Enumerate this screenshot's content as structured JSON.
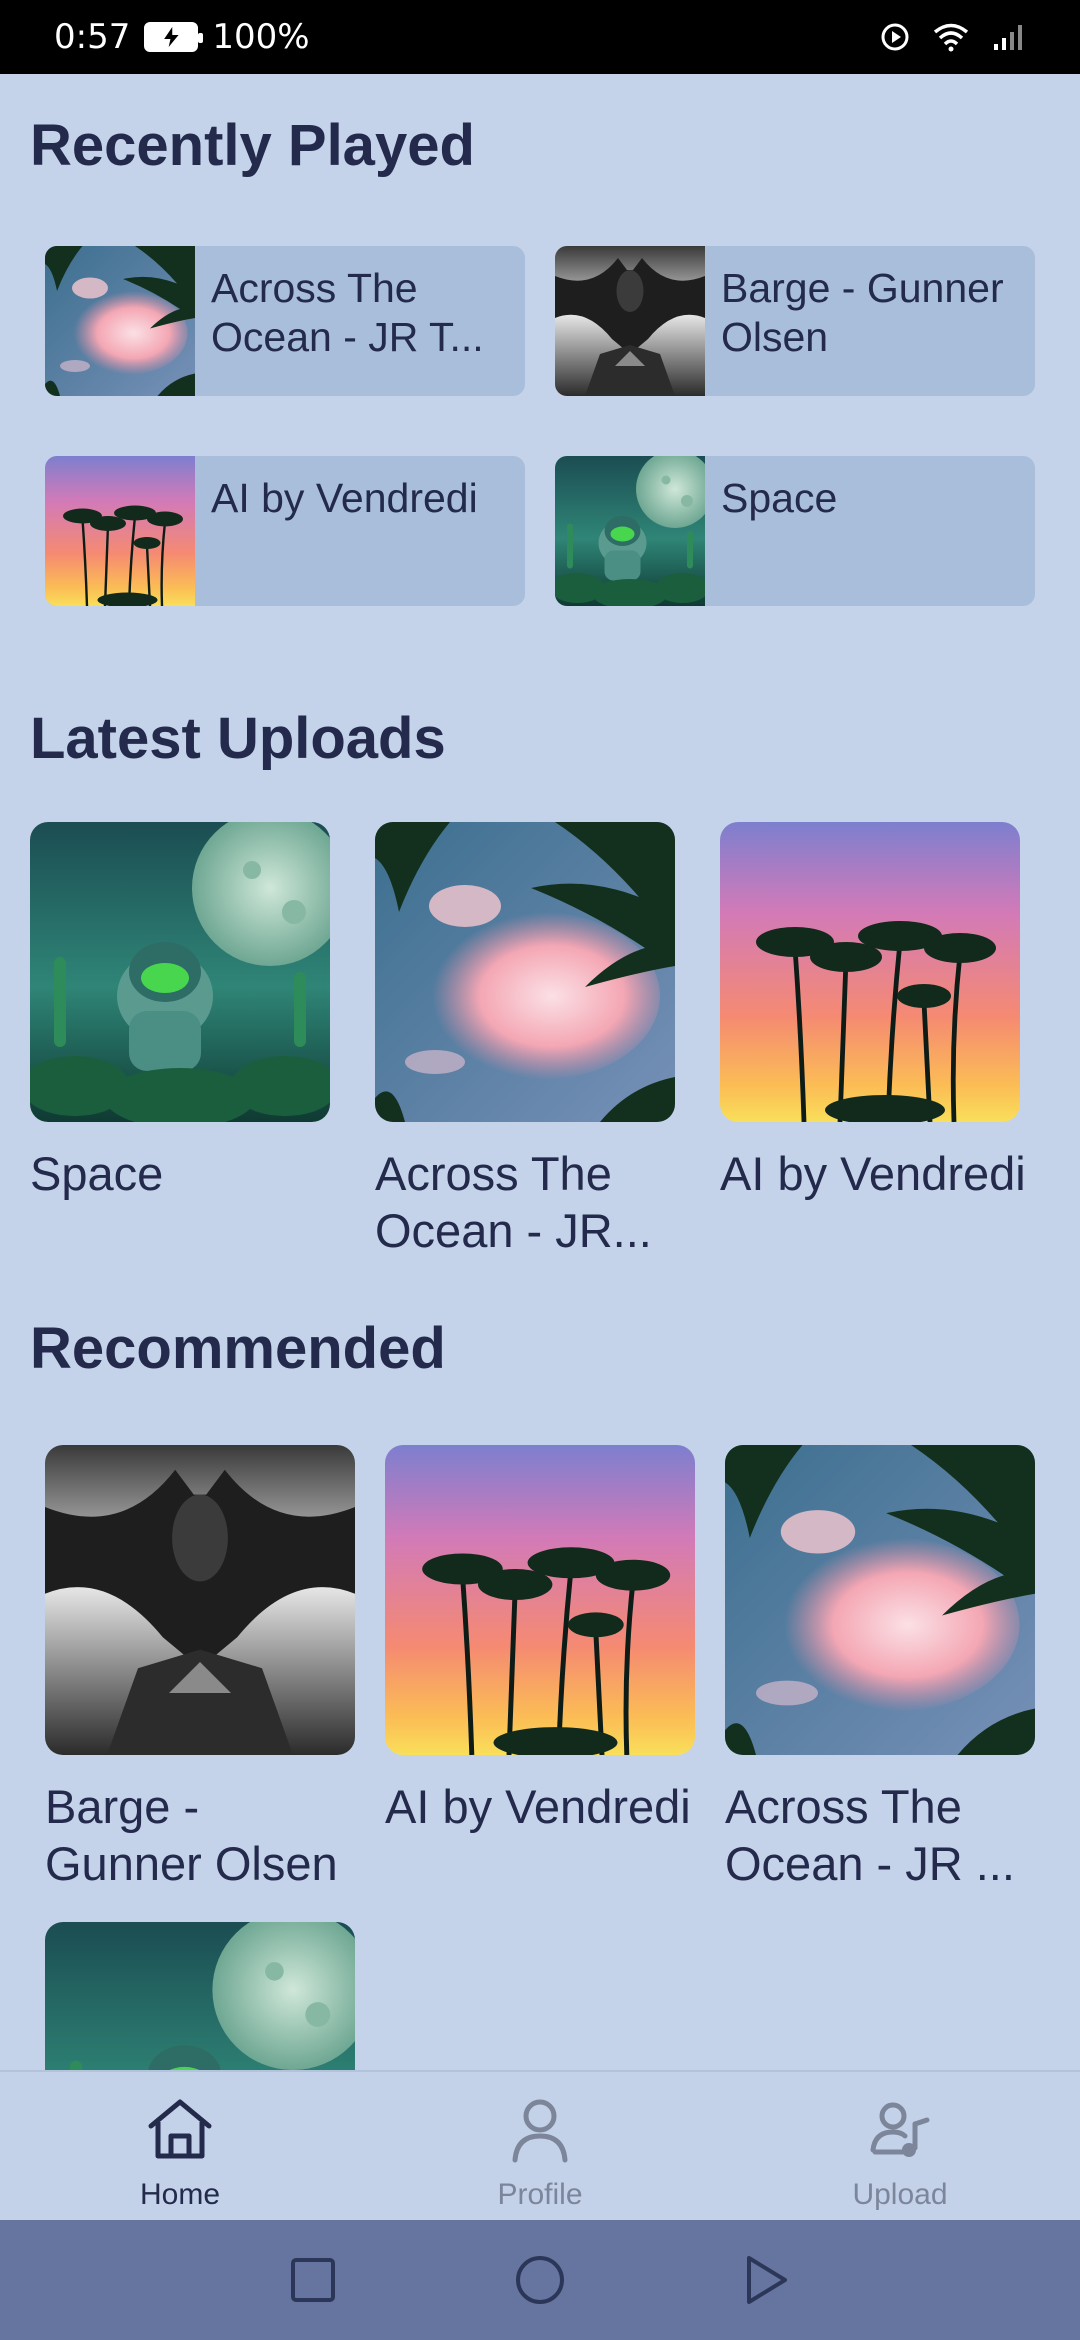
{
  "status_bar": {
    "time": "0:57",
    "battery": "100%"
  },
  "sections": {
    "recently_played": "Recently Played",
    "latest_uploads": "Latest Uploads",
    "recommended": "Recommended"
  },
  "recently_played": [
    {
      "title": "Across The Ocean - JR T...",
      "art": "palms-clouds"
    },
    {
      "title": "Barge - Gunner Olsen",
      "art": "batman"
    },
    {
      "title": "AI by Vendredi",
      "art": "palms-sunset"
    },
    {
      "title": "Space",
      "art": "astronaut"
    }
  ],
  "latest_uploads": [
    {
      "title": "Space",
      "art": "astronaut"
    },
    {
      "title": "Across The Ocean - JR...",
      "art": "palms-clouds"
    },
    {
      "title": "AI by Vendredi",
      "art": "palms-sunset"
    }
  ],
  "recommended": [
    {
      "title": "Barge - Gunner Olsen",
      "art": "batman"
    },
    {
      "title": "AI by Vendredi",
      "art": "palms-sunset"
    },
    {
      "title": "Across The Ocean - JR ...",
      "art": "palms-clouds"
    },
    {
      "title": "",
      "art": "astronaut"
    }
  ],
  "bottom_nav": [
    {
      "label": "Home",
      "icon": "home-icon",
      "active": true
    },
    {
      "label": "Profile",
      "icon": "profile-icon",
      "active": false
    },
    {
      "label": "Upload",
      "icon": "upload-icon",
      "active": false
    }
  ],
  "colors": {
    "background": "#c4d3e9",
    "card": "#a9bedb",
    "text": "#232a4c",
    "system_nav": "#65759f"
  }
}
